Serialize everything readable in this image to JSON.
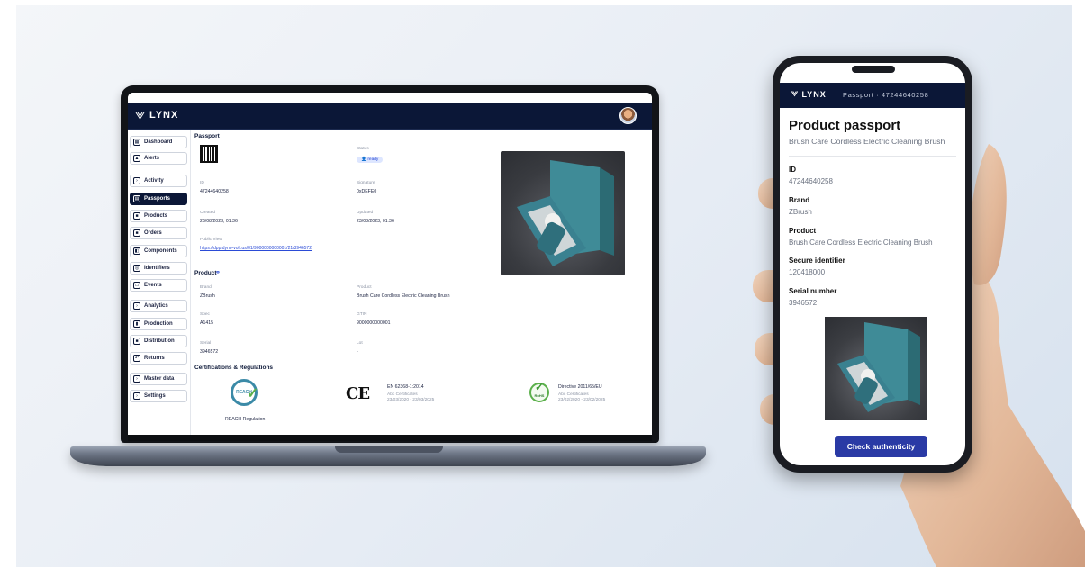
{
  "laptop": {
    "header": {
      "logo": "LYNX"
    },
    "sidebar": {
      "items": [
        {
          "label": "Dashboard",
          "icon": "dashboard-icon"
        },
        {
          "label": "Alerts",
          "icon": "alert-icon"
        },
        {
          "label": "Activity",
          "icon": "chevron-icon"
        },
        {
          "label": "Passports",
          "icon": "passport-icon",
          "active": true
        },
        {
          "label": "Products",
          "icon": "box-icon"
        },
        {
          "label": "Orders",
          "icon": "order-icon"
        },
        {
          "label": "Components",
          "icon": "component-icon"
        },
        {
          "label": "Identifiers",
          "icon": "identifier-icon"
        },
        {
          "label": "Events",
          "icon": "calendar-icon"
        },
        {
          "label": "Analytics",
          "icon": "chevron-icon"
        },
        {
          "label": "Production",
          "icon": "chart-icon"
        },
        {
          "label": "Distribution",
          "icon": "truck-icon"
        },
        {
          "label": "Returns",
          "icon": "return-icon"
        },
        {
          "label": "Master data",
          "icon": "chevron-icon"
        },
        {
          "label": "Settings",
          "icon": "chevron-icon"
        }
      ]
    },
    "passport": {
      "title": "Passport",
      "status_label": "Status",
      "status_value": "ready",
      "id_label": "ID",
      "id_value": "47244640258",
      "signature_label": "Signature",
      "signature_value": "0xDEFE0",
      "created_label": "Created",
      "created_value": "23/08/2023, 01:36",
      "updated_label": "Updated",
      "updated_value": "23/08/2023, 01:36",
      "public_view_label": "Public View",
      "public_view_url": "https://dpp.dyno-volt.us/01/9000000000001/21/3946572"
    },
    "product": {
      "title": "Product",
      "brand_label": "Brand",
      "brand_value": "ZBrush",
      "product_label": "Product",
      "product_value": "Brush Care Cordless Electric Cleaning Brush",
      "spec_label": "Spec",
      "spec_value": "A1415",
      "gtin_label": "GTIN",
      "gtin_value": "9000000000001",
      "serial_label": "Serial",
      "serial_value": "3946572",
      "lot_label": "Lot",
      "lot_value": "-"
    },
    "certifications": {
      "title": "Certifications & Regulations",
      "reach_label": "REACH Regulation",
      "reach_badge": "REACH",
      "ce_mark": "CE",
      "ce_title": "EN 62368-1:2014",
      "ce_issuer": "Abc Certificates",
      "ce_period": "23/03/2020 - 23/03/2025",
      "rohs_badge": "RoHS",
      "rohs_title": "Directive 2011/65/EU",
      "rohs_issuer": "Abc Certificates",
      "rohs_period": "23/02/2020 - 23/02/2025"
    }
  },
  "phone": {
    "header_logo": "LYNX",
    "header_title": "Passport · 47244640258",
    "title": "Product passport",
    "subtitle": "Brush Care Cordless Electric Cleaning Brush",
    "fields": [
      {
        "label": "ID",
        "value": "47244640258"
      },
      {
        "label": "Brand",
        "value": "ZBrush"
      },
      {
        "label": "Product",
        "value": "Brush Care Cordless Electric Cleaning Brush"
      },
      {
        "label": "Secure identifier",
        "value": "120418000"
      },
      {
        "label": "Serial number",
        "value": "3946572"
      }
    ],
    "button": "Check authenticity"
  },
  "colors": {
    "navy": "#0b1737",
    "accent_blue": "#2a3aa5",
    "link_blue": "#2b4bd6",
    "teal_box": "#3f8b97"
  }
}
